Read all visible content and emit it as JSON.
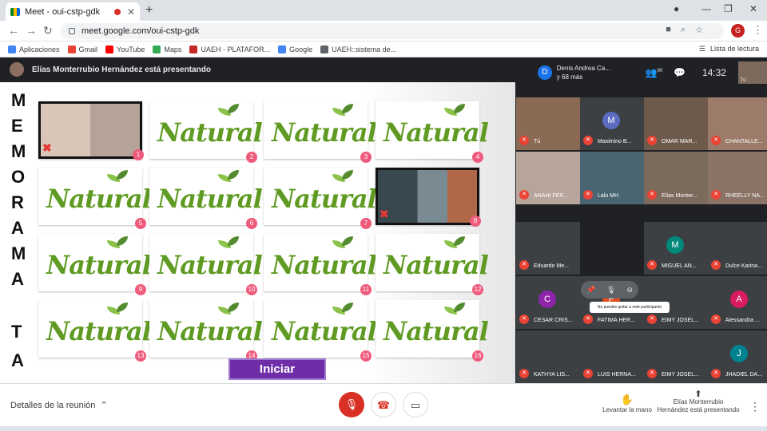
{
  "browser": {
    "tab_title": "Meet - oui-cstp-gdk",
    "url": "meet.google.com/oui-cstp-gdk",
    "bookmarks": [
      {
        "label": "Aplicaciones",
        "color": "#4285f4"
      },
      {
        "label": "Gmail",
        "color": "#ea4335"
      },
      {
        "label": "YouTube",
        "color": "#ff0000"
      },
      {
        "label": "Maps",
        "color": "#34a853"
      },
      {
        "label": "UAEH - PLATAFOR...",
        "color": "#c62828"
      },
      {
        "label": "Google",
        "color": "#4285f4"
      },
      {
        "label": "UAEH::sistema de...",
        "color": "#5f6368"
      }
    ],
    "reading_list": "Lista de lectura",
    "profile_initial": "G"
  },
  "meet": {
    "presenter_banner": "Elías Monterrubio Hernández está presentando",
    "participants_header": {
      "initial": "D",
      "line1": "Denis Andrea Ca...",
      "line2": "y 68 más",
      "people_count": "90",
      "time": "14:32",
      "self_label": "Tú"
    },
    "slide": {
      "letters_col": [
        "M",
        "E",
        "M",
        "O",
        "R",
        "A",
        "M",
        "A",
        "T",
        "A"
      ],
      "card_word": "Natural",
      "cards": [
        {
          "n": "1",
          "type": "photo1"
        },
        {
          "n": "2",
          "type": "word"
        },
        {
          "n": "3",
          "type": "word"
        },
        {
          "n": "4",
          "type": "word"
        },
        {
          "n": "5",
          "type": "word"
        },
        {
          "n": "6",
          "type": "word"
        },
        {
          "n": "7",
          "type": "word"
        },
        {
          "n": "8",
          "type": "photo2"
        },
        {
          "n": "9",
          "type": "word"
        },
        {
          "n": "10",
          "type": "word"
        },
        {
          "n": "11",
          "type": "word"
        },
        {
          "n": "12",
          "type": "word"
        },
        {
          "n": "13",
          "type": "word"
        },
        {
          "n": "14",
          "type": "word"
        },
        {
          "n": "15",
          "type": "word"
        },
        {
          "n": "16",
          "type": "word"
        }
      ],
      "start_button": "Iniciar"
    },
    "tiles": [
      {
        "name": "Tú",
        "color": "#8a6a55"
      },
      {
        "name": "Maximino B...",
        "color": "#3c4043",
        "initial": "M",
        "ini_color": "#5c6bc0"
      },
      {
        "name": "OMAR MAR...",
        "color": "#6d5a4a"
      },
      {
        "name": "CHANTALLE...",
        "color": "#9c7b6a"
      },
      {
        "name": "ANAHI FER...",
        "color": "#b7a49a"
      },
      {
        "name": "Lalo MH",
        "color": "#4a6572"
      },
      {
        "name": "Elías Monter...",
        "color": "#7b6b5d"
      },
      {
        "name": "RHEELLY NA...",
        "color": "#8b7466"
      },
      {
        "name": "Eduardo Me...",
        "color": "#3c4043"
      },
      {
        "name": "MIGUEL AN...",
        "color": "#3c4043",
        "initial": "M",
        "ini_color": "#00897b"
      },
      {
        "name": "Dulce Karina...",
        "color": "#3c4043"
      },
      {
        "name": "CESAR CRIS...",
        "color": "#3c4043",
        "initial": "C",
        "ini_color": "#8e24aa"
      },
      {
        "name": "FATIMA HER...",
        "color": "#3c4043",
        "initial": "F",
        "ini_color": "#e64a19"
      },
      {
        "name": "EIMY JOSEL...",
        "color": "#3c4043"
      },
      {
        "name": "Alessandra ...",
        "color": "#3c4043",
        "initial": "A",
        "ini_color": "#d81b60"
      },
      {
        "name": "KATHYA LIS...",
        "color": "#3c4043"
      },
      {
        "name": "LUIS HERNA...",
        "color": "#3c4043"
      },
      {
        "name": "EIMY JOSEL...",
        "color": "#3c4043"
      },
      {
        "name": "JHADIEL DA...",
        "color": "#3c4043",
        "initial": "J",
        "ini_color": "#00838f"
      }
    ],
    "tooltip": "No puedes quitar a este participante",
    "bottom": {
      "details": "Detalles de la reunión",
      "raise_hand": "Levantar la mano",
      "presenting": "Elías Monterrubio Hernández está presentando"
    }
  }
}
